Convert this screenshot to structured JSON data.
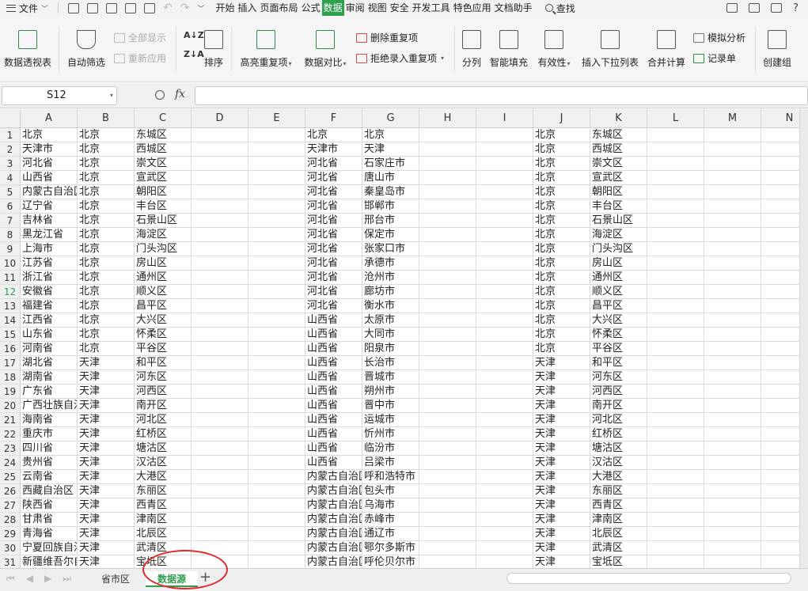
{
  "menubar": {
    "file_label": "文件",
    "menus": [
      "开始",
      "插入",
      "页面布局",
      "公式",
      "数据",
      "审阅",
      "视图",
      "安全",
      "开发工具",
      "特色应用",
      "文档助手"
    ],
    "active_menu": "数据",
    "search_label": "查找"
  },
  "ribbon": {
    "pivot": "数据透视表",
    "autofilter": "自动筛选",
    "show_all": "全部显示",
    "reapply": "重新应用",
    "sort": "排序",
    "highlight_dup": "高亮重复项",
    "compare": "数据对比",
    "remove_dup": "删除重复项",
    "reject_dup": "拒绝录入重复项",
    "split": "分列",
    "flash_fill": "智能填充",
    "validity": "有效性",
    "dropdown_list": "插入下拉列表",
    "consolidate": "合并计算",
    "simulate": "模拟分析",
    "record": "记录单",
    "create_group": "创建组"
  },
  "formula_bar": {
    "name_box": "S12",
    "fx": "fx",
    "value": ""
  },
  "columns": [
    "A",
    "B",
    "C",
    "D",
    "E",
    "F",
    "G",
    "H",
    "I",
    "J",
    "K",
    "L",
    "M",
    "N"
  ],
  "selected_row": 12,
  "rows": [
    [
      "北京",
      "北京",
      "东城区",
      "",
      "",
      "北京",
      "北京",
      "",
      "",
      "北京",
      "东城区",
      "",
      "",
      ""
    ],
    [
      "天津市",
      "北京",
      "西城区",
      "",
      "",
      "天津市",
      "天津",
      "",
      "",
      "北京",
      "西城区",
      "",
      "",
      ""
    ],
    [
      "河北省",
      "北京",
      "崇文区",
      "",
      "",
      "河北省",
      "石家庄市",
      "",
      "",
      "北京",
      "崇文区",
      "",
      "",
      ""
    ],
    [
      "山西省",
      "北京",
      "宣武区",
      "",
      "",
      "河北省",
      "唐山市",
      "",
      "",
      "北京",
      "宣武区",
      "",
      "",
      ""
    ],
    [
      "内蒙古自治区",
      "北京",
      "朝阳区",
      "",
      "",
      "河北省",
      "秦皇岛市",
      "",
      "",
      "北京",
      "朝阳区",
      "",
      "",
      ""
    ],
    [
      "辽宁省",
      "北京",
      "丰台区",
      "",
      "",
      "河北省",
      "邯郸市",
      "",
      "",
      "北京",
      "丰台区",
      "",
      "",
      ""
    ],
    [
      "吉林省",
      "北京",
      "石景山区",
      "",
      "",
      "河北省",
      "邢台市",
      "",
      "",
      "北京",
      "石景山区",
      "",
      "",
      ""
    ],
    [
      "黑龙江省",
      "北京",
      "海淀区",
      "",
      "",
      "河北省",
      "保定市",
      "",
      "",
      "北京",
      "海淀区",
      "",
      "",
      ""
    ],
    [
      "上海市",
      "北京",
      "门头沟区",
      "",
      "",
      "河北省",
      "张家口市",
      "",
      "",
      "北京",
      "门头沟区",
      "",
      "",
      ""
    ],
    [
      "江苏省",
      "北京",
      "房山区",
      "",
      "",
      "河北省",
      "承德市",
      "",
      "",
      "北京",
      "房山区",
      "",
      "",
      ""
    ],
    [
      "浙江省",
      "北京",
      "通州区",
      "",
      "",
      "河北省",
      "沧州市",
      "",
      "",
      "北京",
      "通州区",
      "",
      "",
      ""
    ],
    [
      "安徽省",
      "北京",
      "顺义区",
      "",
      "",
      "河北省",
      "廊坊市",
      "",
      "",
      "北京",
      "顺义区",
      "",
      "",
      ""
    ],
    [
      "福建省",
      "北京",
      "昌平区",
      "",
      "",
      "河北省",
      "衡水市",
      "",
      "",
      "北京",
      "昌平区",
      "",
      "",
      ""
    ],
    [
      "江西省",
      "北京",
      "大兴区",
      "",
      "",
      "山西省",
      "太原市",
      "",
      "",
      "北京",
      "大兴区",
      "",
      "",
      ""
    ],
    [
      "山东省",
      "北京",
      "怀柔区",
      "",
      "",
      "山西省",
      "大同市",
      "",
      "",
      "北京",
      "怀柔区",
      "",
      "",
      ""
    ],
    [
      "河南省",
      "北京",
      "平谷区",
      "",
      "",
      "山西省",
      "阳泉市",
      "",
      "",
      "北京",
      "平谷区",
      "",
      "",
      ""
    ],
    [
      "湖北省",
      "天津",
      "和平区",
      "",
      "",
      "山西省",
      "长治市",
      "",
      "",
      "天津",
      "和平区",
      "",
      "",
      ""
    ],
    [
      "湖南省",
      "天津",
      "河东区",
      "",
      "",
      "山西省",
      "晋城市",
      "",
      "",
      "天津",
      "河东区",
      "",
      "",
      ""
    ],
    [
      "广东省",
      "天津",
      "河西区",
      "",
      "",
      "山西省",
      "朔州市",
      "",
      "",
      "天津",
      "河西区",
      "",
      "",
      ""
    ],
    [
      "广西壮族自治区",
      "天津",
      "南开区",
      "",
      "",
      "山西省",
      "晋中市",
      "",
      "",
      "天津",
      "南开区",
      "",
      "",
      ""
    ],
    [
      "海南省",
      "天津",
      "河北区",
      "",
      "",
      "山西省",
      "运城市",
      "",
      "",
      "天津",
      "河北区",
      "",
      "",
      ""
    ],
    [
      "重庆市",
      "天津",
      "红桥区",
      "",
      "",
      "山西省",
      "忻州市",
      "",
      "",
      "天津",
      "红桥区",
      "",
      "",
      ""
    ],
    [
      "四川省",
      "天津",
      "塘沽区",
      "",
      "",
      "山西省",
      "临汾市",
      "",
      "",
      "天津",
      "塘沽区",
      "",
      "",
      ""
    ],
    [
      "贵州省",
      "天津",
      "汉沽区",
      "",
      "",
      "山西省",
      "吕梁市",
      "",
      "",
      "天津",
      "汉沽区",
      "",
      "",
      ""
    ],
    [
      "云南省",
      "天津",
      "大港区",
      "",
      "",
      "内蒙古自治区",
      "呼和浩特市",
      "",
      "",
      "天津",
      "大港区",
      "",
      "",
      ""
    ],
    [
      "西藏自治区",
      "天津",
      "东丽区",
      "",
      "",
      "内蒙古自治区",
      "包头市",
      "",
      "",
      "天津",
      "东丽区",
      "",
      "",
      ""
    ],
    [
      "陕西省",
      "天津",
      "西青区",
      "",
      "",
      "内蒙古自治区",
      "乌海市",
      "",
      "",
      "天津",
      "西青区",
      "",
      "",
      ""
    ],
    [
      "甘肃省",
      "天津",
      "津南区",
      "",
      "",
      "内蒙古自治区",
      "赤峰市",
      "",
      "",
      "天津",
      "津南区",
      "",
      "",
      ""
    ],
    [
      "青海省",
      "天津",
      "北辰区",
      "",
      "",
      "内蒙古自治区",
      "通辽市",
      "",
      "",
      "天津",
      "北辰区",
      "",
      "",
      ""
    ],
    [
      "宁夏回族自治区",
      "天津",
      "武清区",
      "",
      "",
      "内蒙古自治区",
      "鄂尔多斯市",
      "",
      "",
      "天津",
      "武清区",
      "",
      "",
      ""
    ],
    [
      "新疆维吾尔自治区",
      "天津",
      "宝坻区",
      "",
      "",
      "内蒙古自治区",
      "呼伦贝尔市",
      "",
      "",
      "天津",
      "宝坻区",
      "",
      "",
      ""
    ]
  ],
  "sheet_tabs": {
    "province_tab": "省市区",
    "source_tab": "数据源",
    "add_tab": "+"
  }
}
